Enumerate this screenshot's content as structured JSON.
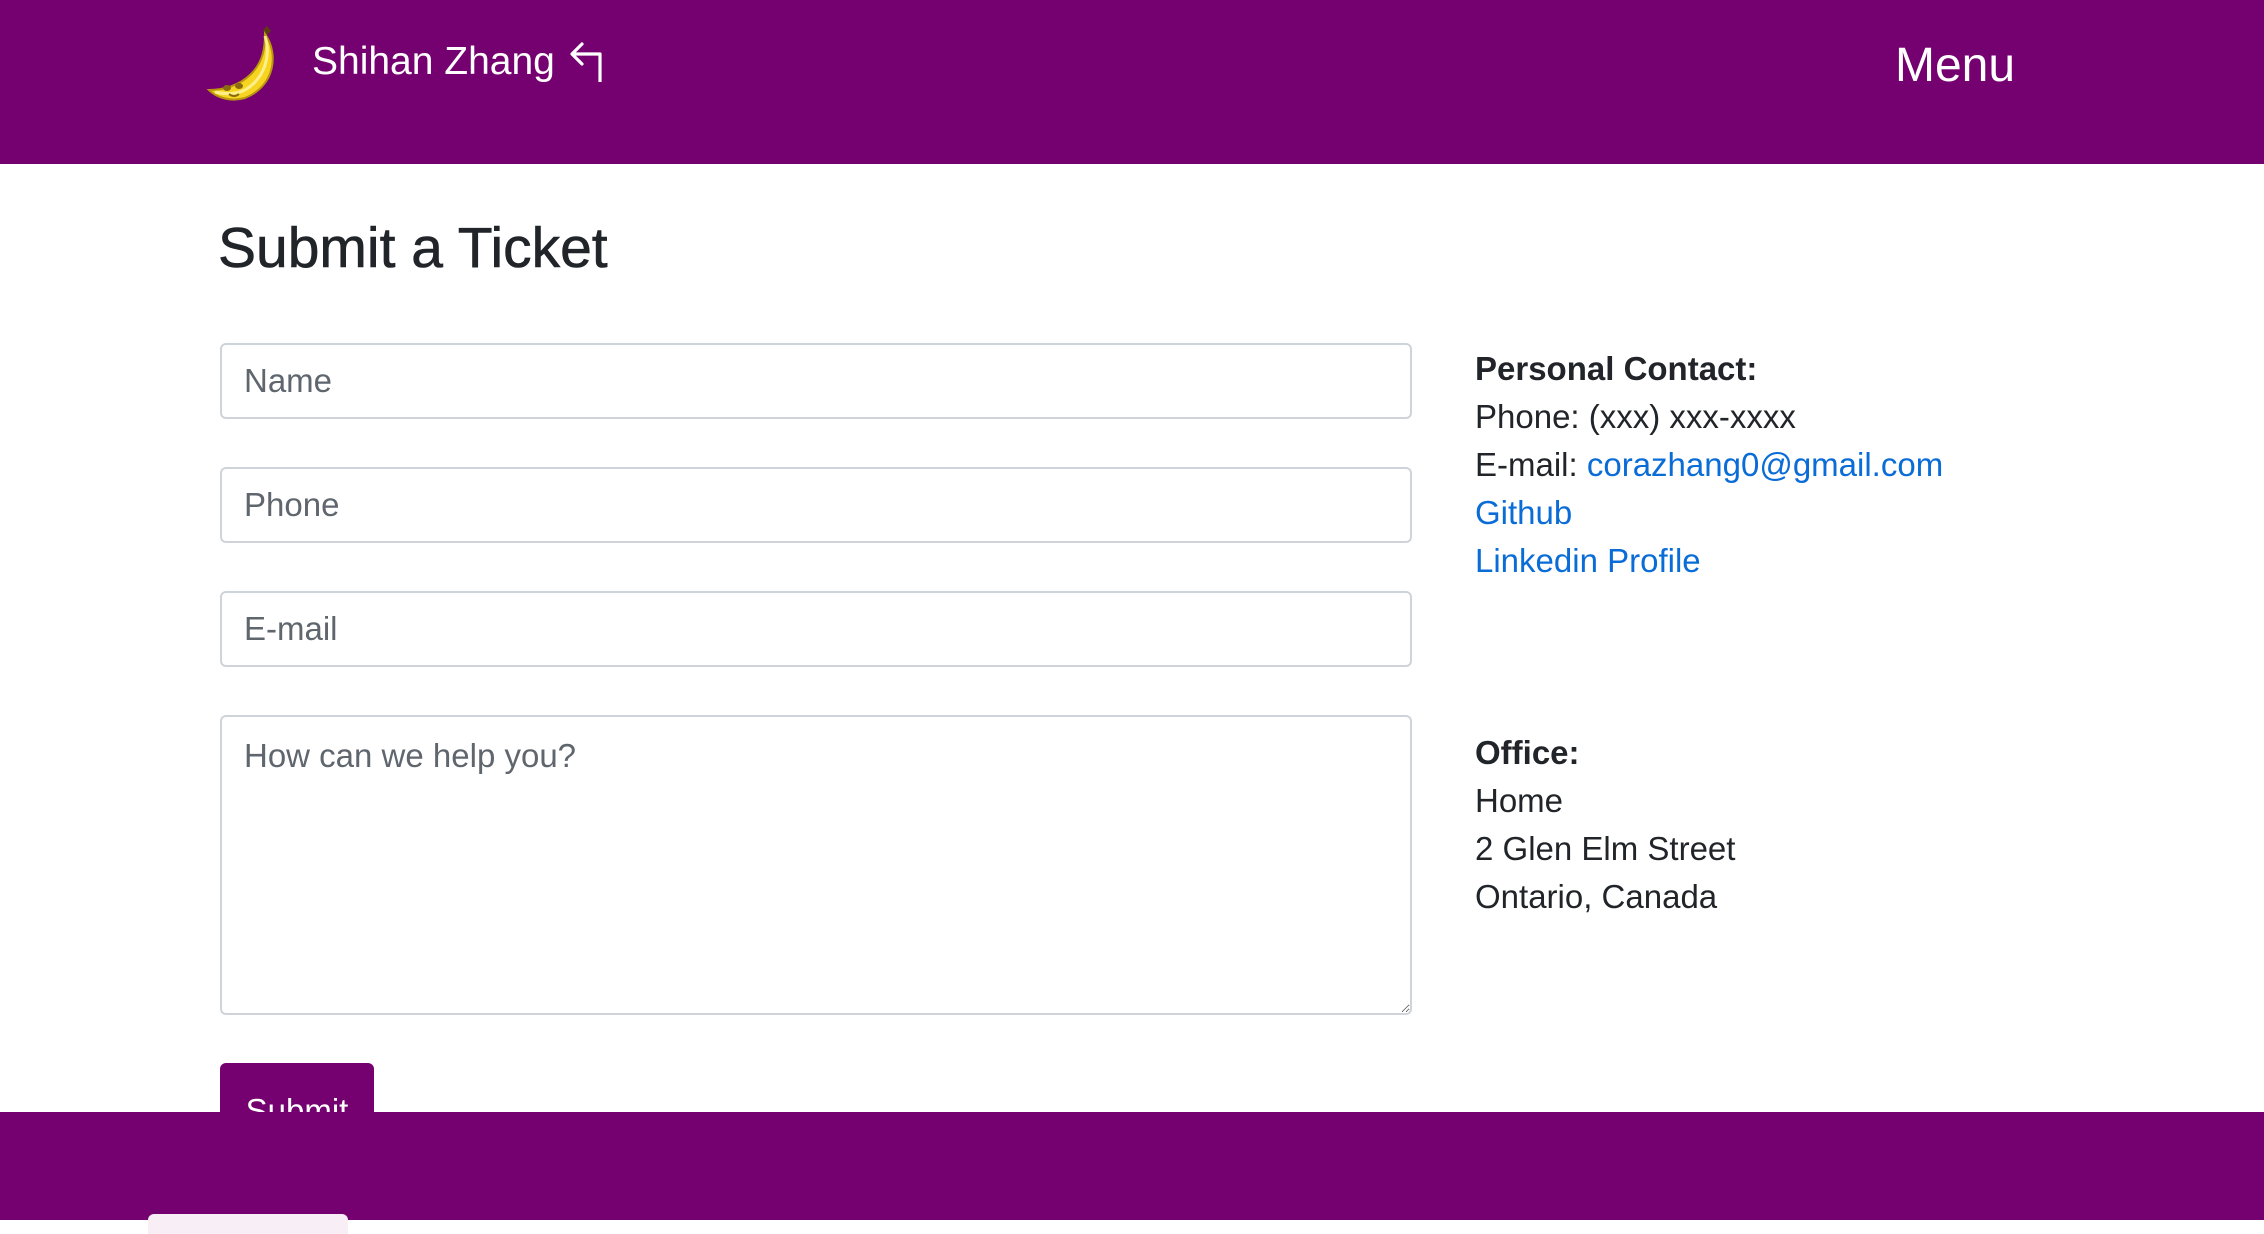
{
  "navbar": {
    "brand_name": "Shihan Zhang",
    "logo_icon": "banana-icon",
    "back_icon": "return-arrow-icon",
    "menu_label": "Menu",
    "background_color": "#750070"
  },
  "page": {
    "title": "Submit a Ticket"
  },
  "form": {
    "name_placeholder": "Name",
    "phone_placeholder": "Phone",
    "email_placeholder": "E-mail",
    "message_placeholder": "How can we help you?",
    "submit_label": "Submit"
  },
  "contact": {
    "heading": "Personal Contact:",
    "phone_label": "Phone:",
    "phone_value": "(xxx) xxx-xxxx",
    "email_label": "E-mail:",
    "email_value": "corazhang0@gmail.com",
    "github_label": "Github",
    "linkedin_label": "Linkedin Profile",
    "link_color": "#0a6cd6"
  },
  "office": {
    "heading": "Office:",
    "line1": "Home",
    "line2": "2 Glen Elm Street",
    "line3": "Ontario, Canada"
  },
  "footer": {
    "background_color": "#750070"
  }
}
